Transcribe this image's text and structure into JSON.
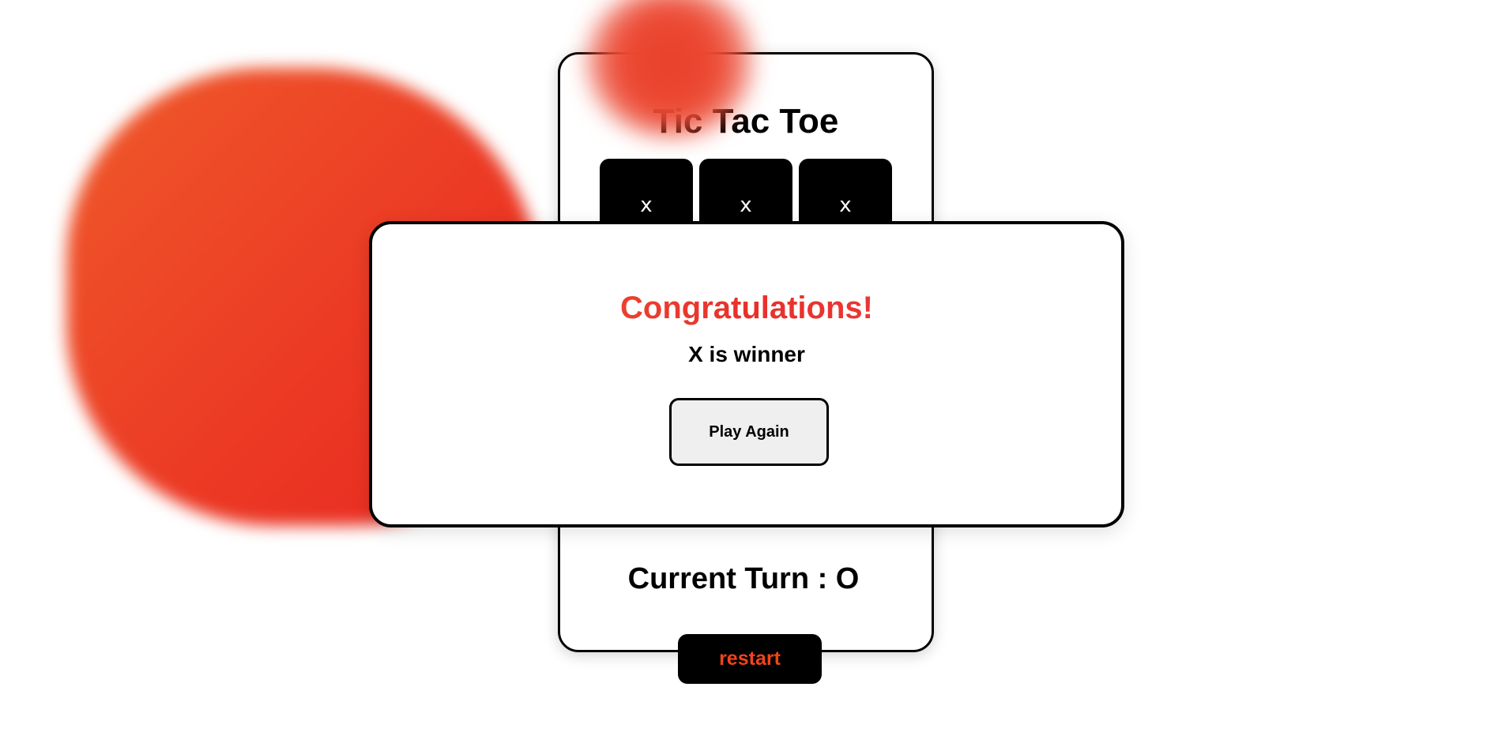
{
  "game": {
    "title": "Tic Tac Toe",
    "board": [
      "x",
      "x",
      "x",
      "",
      "",
      "",
      "",
      "",
      ""
    ]
  },
  "modal": {
    "heading": "Congratulations!",
    "message": "X is winner",
    "play_again_label": "Play Again"
  },
  "status": {
    "current_turn": "Current Turn : O"
  },
  "controls": {
    "restart_label": "restart"
  },
  "colors": {
    "accent": "#f0441a",
    "blob": "#ec3b25",
    "cell_background": "#000000",
    "modal_button_background": "#efefef"
  }
}
